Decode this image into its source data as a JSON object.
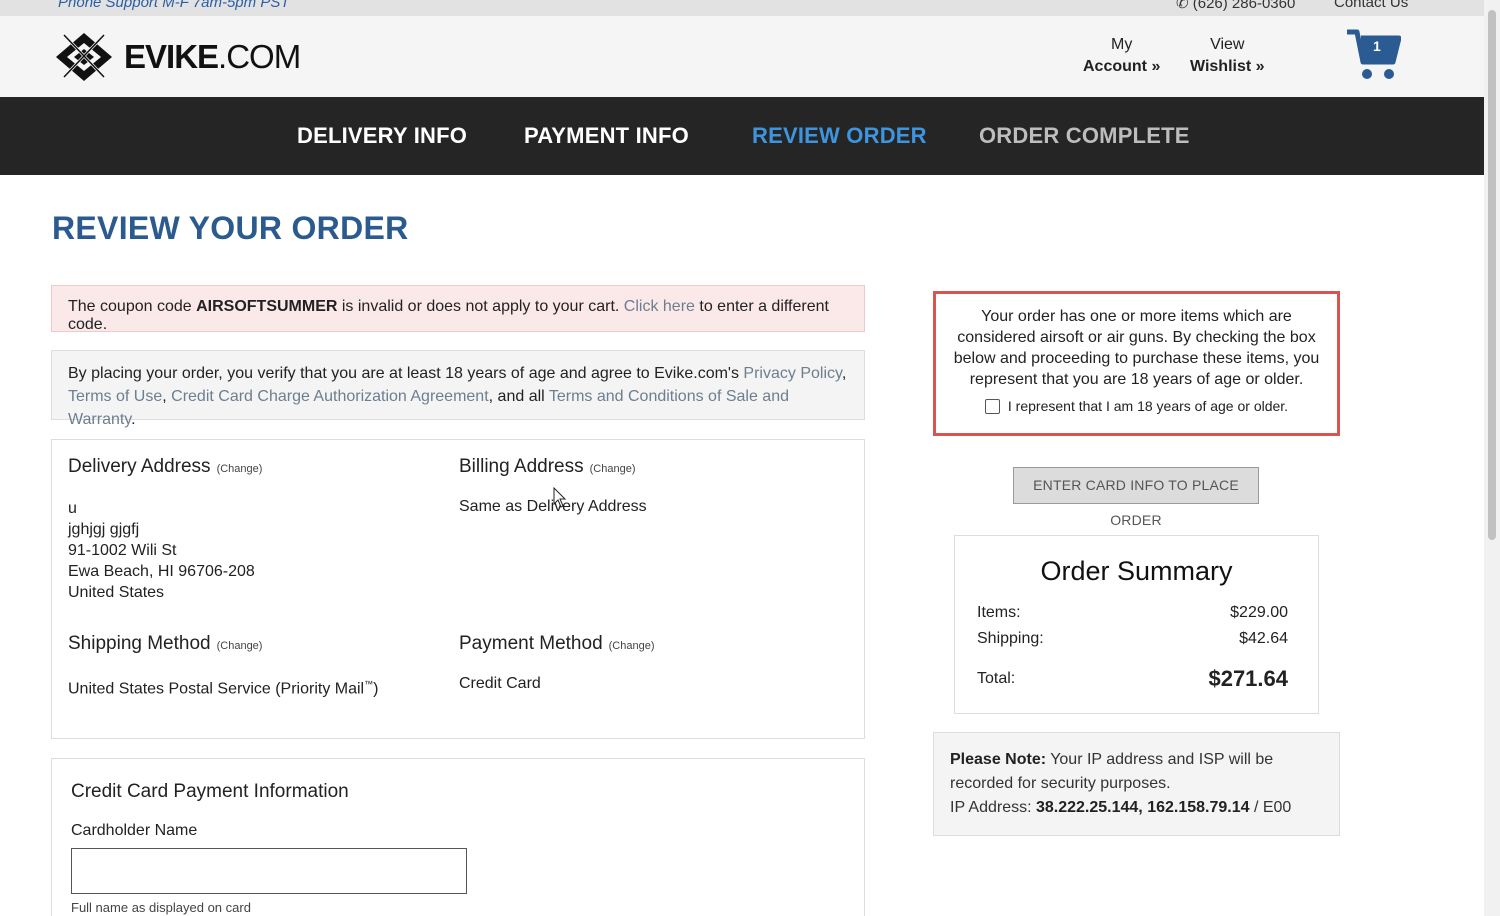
{
  "topbar": {
    "support": "Phone Support M-F 7am-5pm PST",
    "phone": "(626) 286-0360",
    "contact": "Contact Us"
  },
  "header": {
    "logo_bold": "EVIKE",
    "logo_rest": ".COM",
    "account_line1": "My",
    "account_line2": "Account »",
    "wishlist_line1": "View",
    "wishlist_line2": "Wishlist »",
    "cart_count": "1"
  },
  "nav": {
    "delivery": "DELIVERY INFO",
    "payment": "PAYMENT INFO",
    "review": "REVIEW ORDER",
    "complete": "ORDER COMPLETE"
  },
  "page_title": "REVIEW YOUR ORDER",
  "coupon_alert": {
    "pre": "The coupon code ",
    "code": "AIRSOFTSUMMER",
    "mid": " is invalid or does not apply to your cart. ",
    "link": "Click here",
    "post": " to enter a different code."
  },
  "terms": {
    "pre": "By placing your order, you verify that you are at least 18 years of age and agree to Evike.com's ",
    "privacy": "Privacy Policy",
    "comma1": ", ",
    "tou": "Terms of Use",
    "comma2": ", ",
    "cc_agreement": "Credit Card Charge Authorization Agreement",
    "and_all": ", and all ",
    "tcs": "Terms and Conditions of Sale and Warranty",
    "end": "."
  },
  "delivery": {
    "heading": "Delivery Address",
    "change": "(Change)",
    "lines": [
      "u",
      "jghjgj gjgfj",
      "91-1002 Wili St",
      "Ewa Beach, HI 96706-208",
      "United States"
    ]
  },
  "billing": {
    "heading": "Billing Address",
    "change": "(Change)",
    "value": "Same as Delivery Address"
  },
  "shipping": {
    "heading": "Shipping Method",
    "change": "(Change)",
    "value": "United States Postal Service (Priority Mail",
    "tm": "™",
    "close": ")"
  },
  "payment": {
    "heading": "Payment Method",
    "change": "(Change)",
    "value": "Credit Card"
  },
  "cc": {
    "title": "Credit Card Payment Information",
    "cardholder_label": "Cardholder Name",
    "cardholder_value": "",
    "help": "Full name as displayed on card"
  },
  "age": {
    "text": "Your order has one or more items which are considered airsoft or air guns. By checking the box below and proceeding to purchase these items, you represent that you are 18 years of age or older.",
    "checkbox_label": "I represent that I am 18 years of age or older.",
    "checked": false
  },
  "place_order": "ENTER CARD INFO TO PLACE ORDER",
  "summary": {
    "title": "Order Summary",
    "items_label": "Items:",
    "items_value": "$229.00",
    "shipping_label": "Shipping:",
    "shipping_value": "$42.64",
    "total_label": "Total:",
    "total_value": "$271.64"
  },
  "note": {
    "label": "Please Note:",
    "text": " Your IP address and ISP will be recorded for security purposes.",
    "ip_label": "IP Address: ",
    "ip_value": "38.222.25.144, 162.158.79.14",
    "ip_suffix": " / E00"
  },
  "colors": {
    "nav_bg": "#252525",
    "nav_active": "#3d95e0",
    "title_blue": "#2b5a8f",
    "alert_bg": "#fbe9ea",
    "age_border": "#d9534f"
  }
}
